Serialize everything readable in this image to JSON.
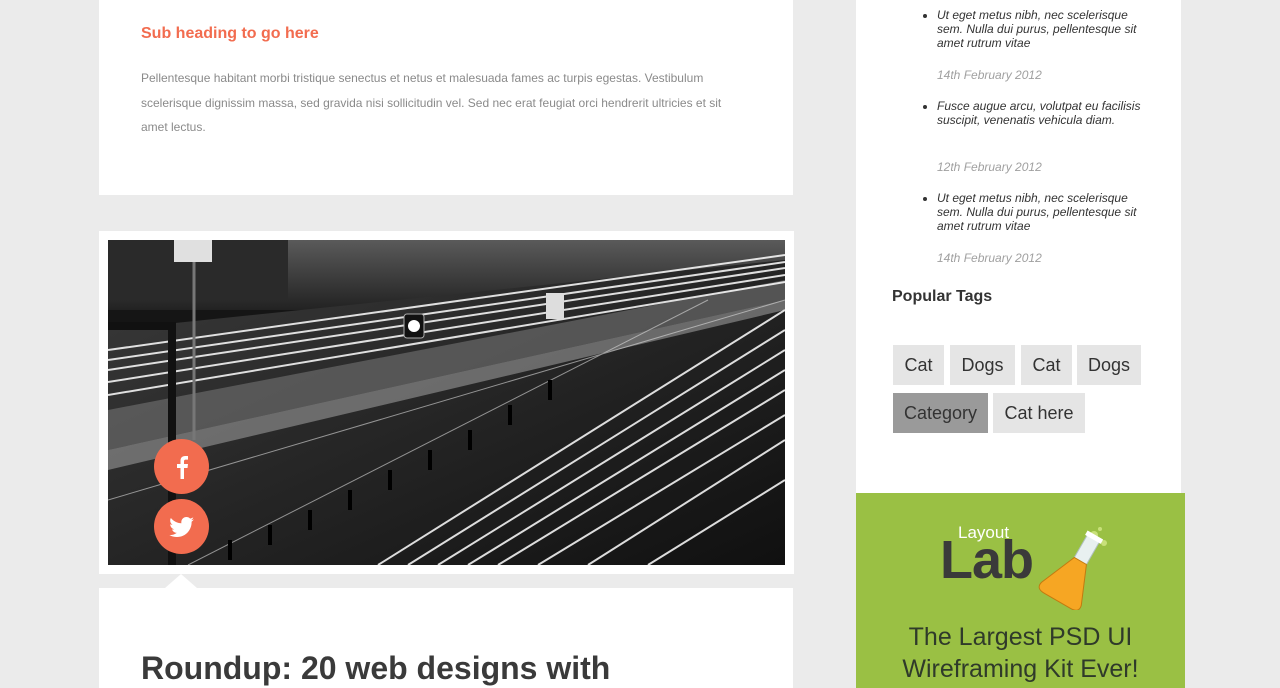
{
  "post_top": {
    "subheading": "Sub heading to go here",
    "paragraph": "Pellentesque habitant morbi tristique senectus et netus et malesuada fames ac turpis egestas. Vestibulum scelerisque dignissim massa, sed gravida nisi sollicitudin vel. Sed nec erat feugiat orci hendrerit ultricies et sit amet lectus."
  },
  "social": {
    "facebook_icon": "facebook-icon",
    "twitter_icon": "twitter-icon"
  },
  "post_bottom": {
    "title": "Roundup: 20 web designs with"
  },
  "sidebar": {
    "news": [
      {
        "text": "Ut eget metus nibh, nec scelerisque sem. Nulla dui purus, pellentesque sit amet rutrum vitae",
        "date": "14th February 2012"
      },
      {
        "text": "Fusce augue arcu, volutpat eu facilisis suscipit, venenatis vehicula diam.",
        "date": "12th February 2012"
      },
      {
        "text": "Ut eget metus nibh, nec scelerisque sem. Nulla dui purus, pellentesque sit amet rutrum vitae",
        "date": "14th February 2012"
      }
    ],
    "tags_heading": "Popular Tags",
    "tags": [
      "Cat",
      "Dogs",
      "Cat",
      "Dogs",
      "Category",
      "Cat here"
    ],
    "active_tag": "Category"
  },
  "ad": {
    "logo_small": "Layout",
    "logo_big": "Lab",
    "line1": "The Largest PSD UI",
    "line2": "Wireframing Kit Ever!"
  },
  "colors": {
    "accent": "#f26c4f",
    "ad_bg": "#9ac044",
    "page_bg": "#ebebeb"
  }
}
